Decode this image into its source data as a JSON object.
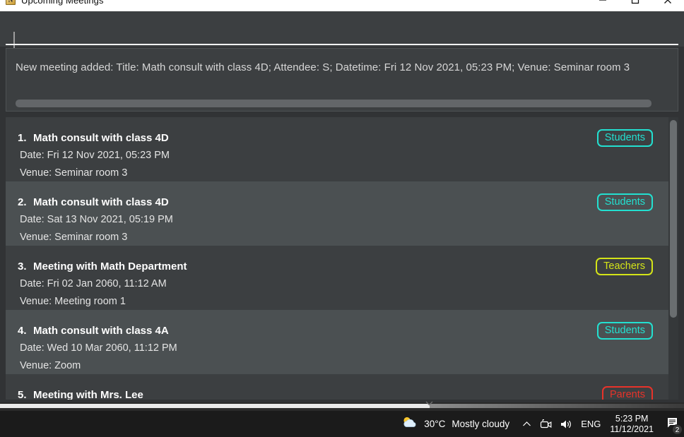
{
  "window": {
    "title": "Upcoming Meetings",
    "icon": "app-icon",
    "controls": {
      "minimize": "minimize-icon",
      "maximize": "maximize-icon",
      "close": "close-icon"
    }
  },
  "command_input": {
    "value": "",
    "placeholder": ""
  },
  "output": {
    "message": "New meeting added: Title: Math consult with class 4D; Attendee: S; Datetime: Fri 12 Nov 2021, 05:23 PM; Venue: Seminar room 3"
  },
  "badge_colors": {
    "Students": "#23e0d0",
    "Teachers": "#d4e418",
    "Parents": "#e8332a"
  },
  "meetings": [
    {
      "number": "1.",
      "title": "Math consult with class 4D",
      "date": "Date: Fri 12 Nov 2021, 05:23 PM",
      "venue": "Venue: Seminar room 3",
      "badge": "Students"
    },
    {
      "number": "2.",
      "title": "Math consult with class 4D",
      "date": "Date: Sat 13 Nov 2021, 05:19 PM",
      "venue": "Venue: Seminar room 3",
      "badge": "Students"
    },
    {
      "number": "3.",
      "title": "Meeting with Math Department",
      "date": "Date: Fri 02 Jan 2060, 11:12 AM",
      "venue": "Venue: Meeting room 1",
      "badge": "Teachers"
    },
    {
      "number": "4.",
      "title": "Math consult with class 4A",
      "date": "Date: Wed 10 Mar 2060, 11:12 PM",
      "venue": "Venue: Zoom",
      "badge": "Students"
    },
    {
      "number": "5.",
      "title": "Meeting with Mrs. Lee",
      "date": "",
      "venue": "",
      "badge": "Parents"
    }
  ],
  "taskbar": {
    "weather": {
      "icon": "partly-cloudy-icon",
      "temperature": "30°C",
      "description": "Mostly cloudy"
    },
    "show_hidden_icons": "chevron-up-icon",
    "camera": "camera-icon",
    "volume": "speaker-icon",
    "language": "ENG",
    "clock": {
      "time": "5:23 PM",
      "date": "11/12/2021"
    },
    "notifications": {
      "icon": "notification-icon",
      "count": "2"
    }
  }
}
